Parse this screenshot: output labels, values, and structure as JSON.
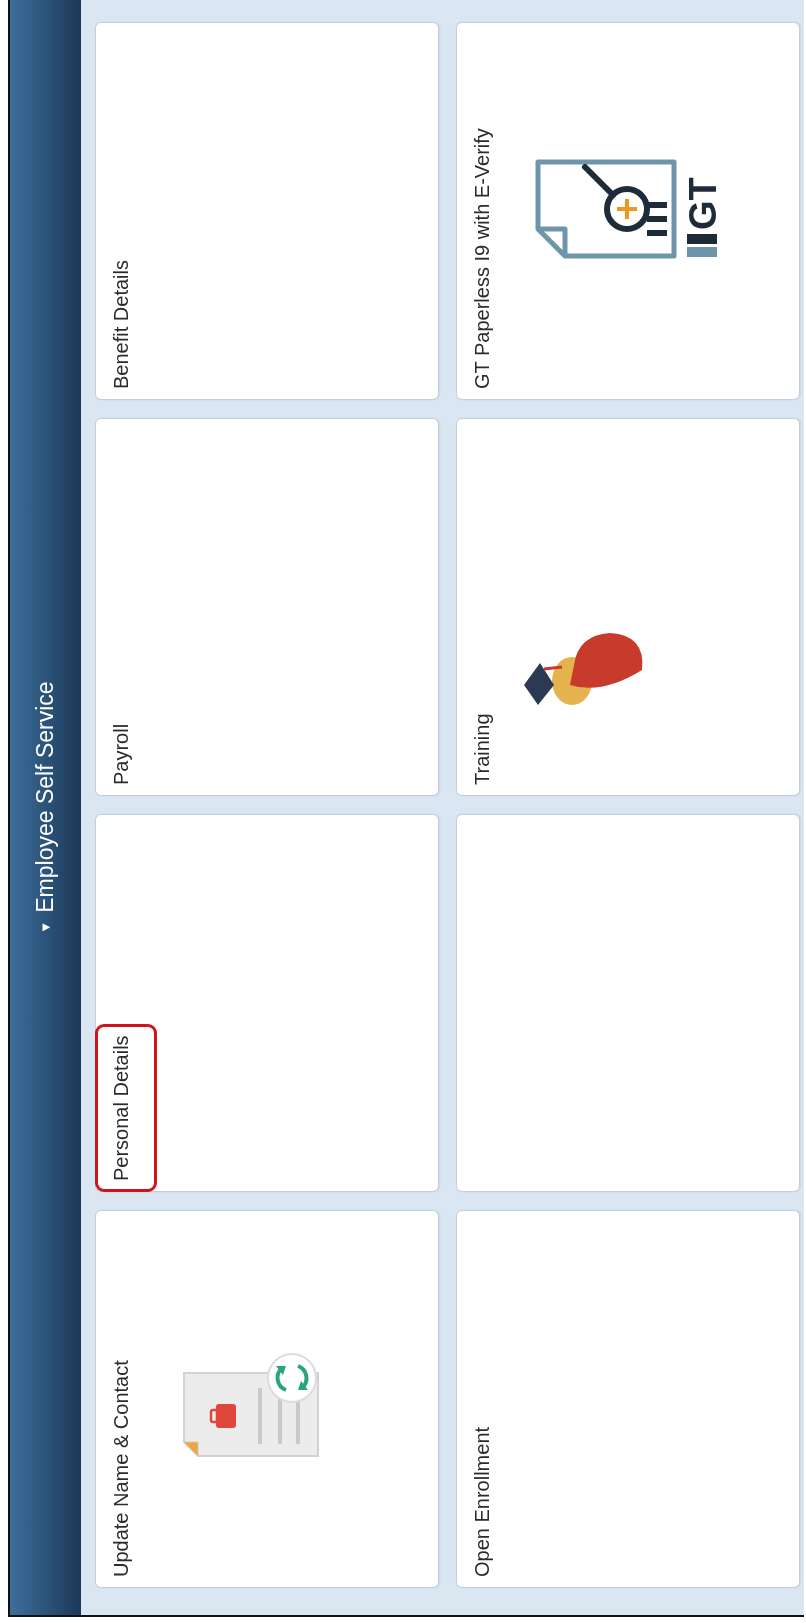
{
  "header": {
    "toggle": "▼",
    "title": "Employee Self Service"
  },
  "tiles": [
    {
      "kind": "contact",
      "label": "Update Name & Contact",
      "highlighted": false
    },
    {
      "kind": "plain",
      "label": "Personal Details",
      "highlighted": true
    },
    {
      "kind": "plain",
      "label": "Payroll",
      "highlighted": false
    },
    {
      "kind": "plain",
      "label": "Benefit Details",
      "highlighted": false
    },
    {
      "kind": "plain",
      "label": "Open Enrollment",
      "highlighted": false
    },
    {
      "kind": "blank"
    },
    {
      "kind": "training",
      "label": "Training",
      "highlighted": false
    },
    {
      "kind": "verify",
      "label": "GT Paperless I9 with E-Verify",
      "highlighted": false,
      "logo_text": "GT"
    }
  ]
}
